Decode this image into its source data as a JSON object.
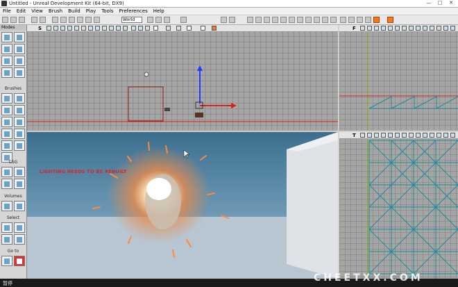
{
  "window": {
    "title": "Untitled - Unreal Development Kit (64-bit, DX9)",
    "buttons": [
      "—",
      "□",
      "✕"
    ]
  },
  "menu": [
    "File",
    "Edit",
    "View",
    "Brush",
    "Build",
    "Play",
    "Tools",
    "Preferences",
    "Help"
  ],
  "toolbar": {
    "coord_system": "World"
  },
  "sidebar": {
    "modes_label": "Modes",
    "brushes_label": "Brushes",
    "csg_label": "CSG",
    "volumes_label": "Volumes",
    "select_label": "Select",
    "goto_label": "Go to"
  },
  "viewport_top": {
    "header_letter": "S"
  },
  "viewport_side": {
    "header_letter": "F"
  },
  "viewport_persp": {
    "warning": "LIGHTING NEEDS TO BE REBUILT"
  },
  "viewport_front": {
    "header_letter": "T"
  },
  "statusbar": {
    "text": "暂停"
  },
  "watermark": "CHEETXX.COM",
  "colors": {
    "accent_red": "#d62020",
    "axis_blue": "#1c3cff",
    "grid": "#a6a6a6",
    "teal_wire": "#1a8c9c"
  }
}
